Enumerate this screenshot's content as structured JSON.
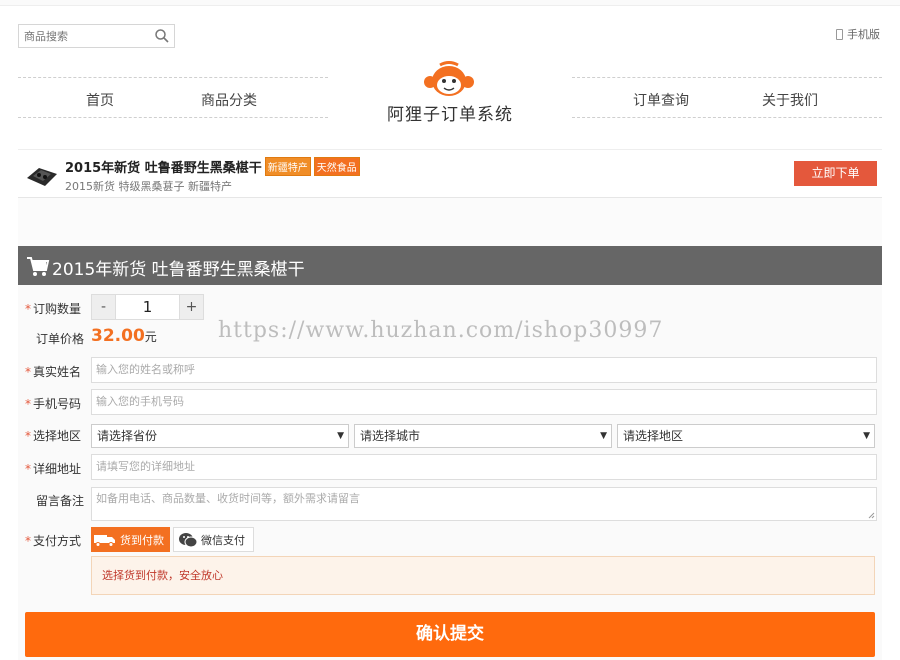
{
  "search": {
    "placeholder": "商品搜索"
  },
  "header": {
    "mobile_label": "手机版",
    "nav_left": [
      "首页",
      "商品分类"
    ],
    "nav_right": [
      "订单查询",
      "关于我们"
    ],
    "logo_text": "阿狸子订单系统"
  },
  "product": {
    "title": "2015年新货 吐鲁番野生黑桑椹干",
    "tags": [
      "新疆特产",
      "天然食品"
    ],
    "subtitle": "2015新货 特级黑桑葚子 新疆特产",
    "order_button": "立即下单"
  },
  "form": {
    "title": "2015年新货 吐鲁番野生黑桑椹干",
    "quantity_label": "订购数量",
    "quantity": "1",
    "minus": "-",
    "plus": "+",
    "price_label": "订单价格",
    "price": "32.00",
    "price_unit": "元",
    "watermark": "https://www.huzhan.com/ishop30997",
    "name_label": "真实姓名",
    "name_placeholder": "输入您的姓名或称呼",
    "phone_label": "手机号码",
    "phone_placeholder": "输入您的手机号码",
    "region_label": "选择地区",
    "province": "请选择省份",
    "city": "请选择城市",
    "district": "请选择地区",
    "address_label": "详细地址",
    "address_placeholder": "请填写您的详细地址",
    "remark_label": "留言备注",
    "remark_placeholder": "如备用电话、商品数量、收货时间等，额外需求请留言",
    "pay_label": "支付方式",
    "pay_cod": "货到付款",
    "pay_wechat": "微信支付",
    "pay_notice": "选择货到付款，安全放心",
    "submit": "确认提交"
  },
  "colors": {
    "accent": "#f37021",
    "order_button": "#e4583c",
    "header_bar": "#666666",
    "required": "#e4583c"
  }
}
